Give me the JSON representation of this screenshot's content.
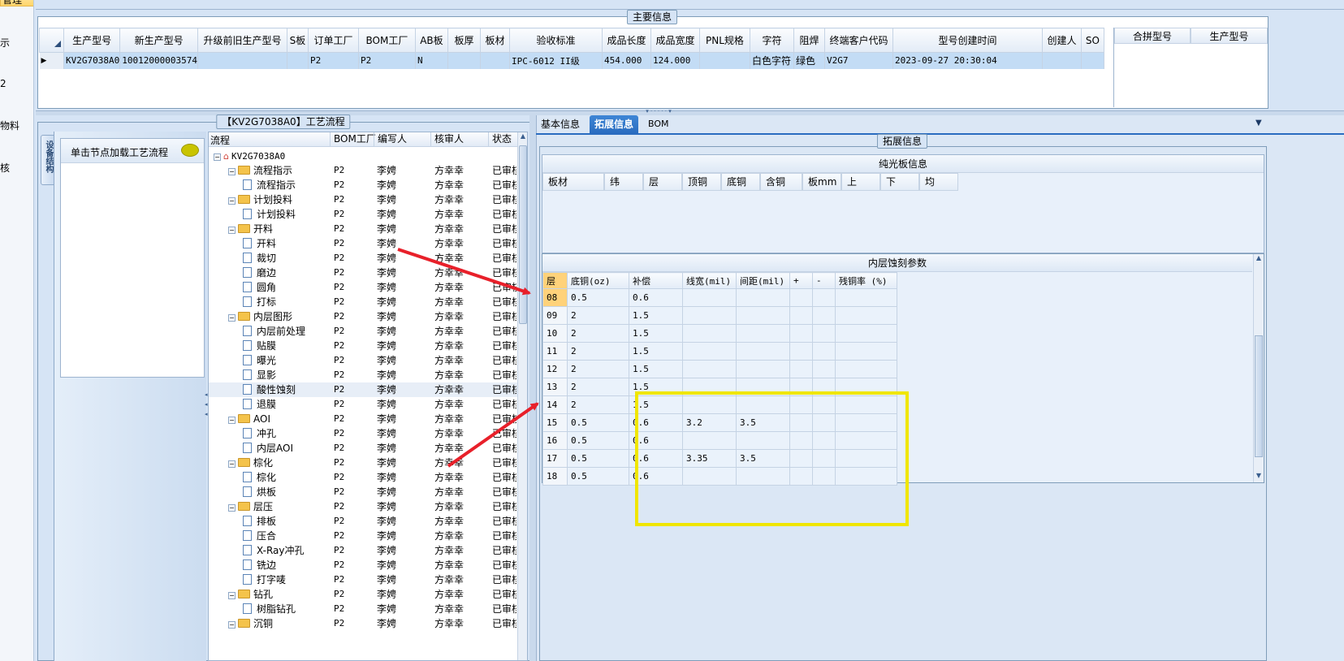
{
  "left_nav": {
    "items": [
      {
        "label": "管理",
        "selected": true
      },
      {
        "label": "示"
      },
      {
        "label": "2"
      },
      {
        "label": "物料"
      },
      {
        "label": "核"
      }
    ]
  },
  "main_info": {
    "title": "主要信息",
    "columns": [
      "生产型号",
      "新生产型号",
      "升级前旧生产型号",
      "S板",
      "订单工厂",
      "BOM工厂",
      "AB板",
      "板厚",
      "板材",
      "验收标准",
      "成品长度",
      "成品宽度",
      "PNL规格",
      "字符",
      "阻焊",
      "终端客户代码",
      "型号创建时间",
      "创建人",
      "SO"
    ],
    "row": [
      "KV2G7038A0",
      "10012000003574",
      "",
      "",
      "P2",
      "P2",
      "N",
      "",
      "",
      "IPC-6012 II级",
      "454.000",
      "124.000",
      "",
      "白色字符",
      "绿色",
      "V2G7",
      "2023-09-27 20:30:04",
      "",
      ""
    ],
    "side_columns": [
      "合拼型号",
      "生产型号"
    ]
  },
  "process_panel": {
    "title": "【KV2G7038A0】工艺流程",
    "vertical_tab": "设备结构",
    "load_hint": "单击节点加载工艺流程",
    "tree_headers": [
      "流程",
      "BOM工厂",
      "编写人",
      "核审人",
      "状态"
    ],
    "tree_rows": [
      {
        "name": "KV2G7038A0",
        "level": 0,
        "type": "root",
        "bom": "",
        "writer": "",
        "reviewer": "",
        "status": ""
      },
      {
        "name": "流程指示",
        "level": 1,
        "type": "folder",
        "bom": "P2",
        "writer": "李娉",
        "reviewer": "方幸幸",
        "status": "已审核"
      },
      {
        "name": "流程指示",
        "level": 2,
        "type": "doc",
        "bom": "P2",
        "writer": "李娉",
        "reviewer": "方幸幸",
        "status": "已审核"
      },
      {
        "name": "计划投料",
        "level": 1,
        "type": "folder",
        "bom": "P2",
        "writer": "李娉",
        "reviewer": "方幸幸",
        "status": "已审核"
      },
      {
        "name": "计划投料",
        "level": 2,
        "type": "doc",
        "bom": "P2",
        "writer": "李娉",
        "reviewer": "方幸幸",
        "status": "已审核"
      },
      {
        "name": "开料",
        "level": 1,
        "type": "folder",
        "bom": "P2",
        "writer": "李娉",
        "reviewer": "方幸幸",
        "status": "已审核"
      },
      {
        "name": "开料",
        "level": 2,
        "type": "doc",
        "bom": "P2",
        "writer": "李娉",
        "reviewer": "方幸幸",
        "status": "已审核"
      },
      {
        "name": "裁切",
        "level": 2,
        "type": "doc",
        "bom": "P2",
        "writer": "李娉",
        "reviewer": "方幸幸",
        "status": "已审核"
      },
      {
        "name": "磨边",
        "level": 2,
        "type": "doc",
        "bom": "P2",
        "writer": "李娉",
        "reviewer": "方幸幸",
        "status": "已审核"
      },
      {
        "name": "圆角",
        "level": 2,
        "type": "doc",
        "bom": "P2",
        "writer": "李娉",
        "reviewer": "方幸幸",
        "status": "已审核"
      },
      {
        "name": "打标",
        "level": 2,
        "type": "doc",
        "bom": "P2",
        "writer": "李娉",
        "reviewer": "方幸幸",
        "status": "已审核"
      },
      {
        "name": "内层图形",
        "level": 1,
        "type": "folder",
        "bom": "P2",
        "writer": "李娉",
        "reviewer": "方幸幸",
        "status": "已审核"
      },
      {
        "name": "内层前处理",
        "level": 2,
        "type": "doc",
        "bom": "P2",
        "writer": "李娉",
        "reviewer": "方幸幸",
        "status": "已审核"
      },
      {
        "name": "贴膜",
        "level": 2,
        "type": "doc",
        "bom": "P2",
        "writer": "李娉",
        "reviewer": "方幸幸",
        "status": "已审核"
      },
      {
        "name": "曝光",
        "level": 2,
        "type": "doc",
        "bom": "P2",
        "writer": "李娉",
        "reviewer": "方幸幸",
        "status": "已审核"
      },
      {
        "name": "显影",
        "level": 2,
        "type": "doc",
        "bom": "P2",
        "writer": "李娉",
        "reviewer": "方幸幸",
        "status": "已审核"
      },
      {
        "name": "酸性蚀刻",
        "level": 2,
        "type": "doc",
        "bom": "P2",
        "writer": "李娉",
        "reviewer": "方幸幸",
        "status": "已审核",
        "selected": true
      },
      {
        "name": "退膜",
        "level": 2,
        "type": "doc",
        "bom": "P2",
        "writer": "李娉",
        "reviewer": "方幸幸",
        "status": "已审核"
      },
      {
        "name": "AOI",
        "level": 1,
        "type": "folder",
        "bom": "P2",
        "writer": "李娉",
        "reviewer": "方幸幸",
        "status": "已审核"
      },
      {
        "name": "冲孔",
        "level": 2,
        "type": "doc",
        "bom": "P2",
        "writer": "李娉",
        "reviewer": "方幸幸",
        "status": "已审核"
      },
      {
        "name": "内层AOI",
        "level": 2,
        "type": "doc",
        "bom": "P2",
        "writer": "李娉",
        "reviewer": "方幸幸",
        "status": "已审核"
      },
      {
        "name": "棕化",
        "level": 1,
        "type": "folder",
        "bom": "P2",
        "writer": "李娉",
        "reviewer": "方幸幸",
        "status": "已审核"
      },
      {
        "name": "棕化",
        "level": 2,
        "type": "doc",
        "bom": "P2",
        "writer": "李娉",
        "reviewer": "方幸幸",
        "status": "已审核"
      },
      {
        "name": "烘板",
        "level": 2,
        "type": "doc",
        "bom": "P2",
        "writer": "李娉",
        "reviewer": "方幸幸",
        "status": "已审核"
      },
      {
        "name": "层压",
        "level": 1,
        "type": "folder",
        "bom": "P2",
        "writer": "李娉",
        "reviewer": "方幸幸",
        "status": "已审核"
      },
      {
        "name": "排板",
        "level": 2,
        "type": "doc",
        "bom": "P2",
        "writer": "李娉",
        "reviewer": "方幸幸",
        "status": "已审核"
      },
      {
        "name": "压合",
        "level": 2,
        "type": "doc",
        "bom": "P2",
        "writer": "李娉",
        "reviewer": "方幸幸",
        "status": "已审核"
      },
      {
        "name": "X-Ray冲孔",
        "level": 2,
        "type": "doc",
        "bom": "P2",
        "writer": "李娉",
        "reviewer": "方幸幸",
        "status": "已审核"
      },
      {
        "name": "铣边",
        "level": 2,
        "type": "doc",
        "bom": "P2",
        "writer": "李娉",
        "reviewer": "方幸幸",
        "status": "已审核"
      },
      {
        "name": "打字唛",
        "level": 2,
        "type": "doc",
        "bom": "P2",
        "writer": "李娉",
        "reviewer": "方幸幸",
        "status": "已审核"
      },
      {
        "name": "钻孔",
        "level": 1,
        "type": "folder",
        "bom": "P2",
        "writer": "李娉",
        "reviewer": "方幸幸",
        "status": "已审核"
      },
      {
        "name": "树脂钻孔",
        "level": 2,
        "type": "doc",
        "bom": "P2",
        "writer": "李娉",
        "reviewer": "方幸幸",
        "status": "已审核"
      },
      {
        "name": "沉铜",
        "level": 1,
        "type": "folder",
        "bom": "P2",
        "writer": "李娉",
        "reviewer": "方幸幸",
        "status": "已审核"
      }
    ]
  },
  "right_panel": {
    "tabs": [
      "基本信息",
      "拓展信息",
      "BOM"
    ],
    "active_tab": "拓展信息",
    "group_title": "拓展信息",
    "light_board": {
      "title": "纯光板信息",
      "columns": [
        "板材",
        "纬",
        "层",
        "顶铜",
        "底铜",
        "含铜",
        "板mm",
        "上",
        "下",
        "均"
      ]
    },
    "etch_params": {
      "title": "内层蚀刻参数",
      "columns": [
        "层",
        "底铜(oz)",
        "补偿",
        "线宽(mil)",
        "间距(mil)",
        "+",
        "-",
        "残铜率 (%)"
      ],
      "rows": [
        [
          "08",
          "0.5",
          "0.6",
          "",
          "",
          "",
          "",
          ""
        ],
        [
          "09",
          "2",
          "1.5",
          "",
          "",
          "",
          "",
          ""
        ],
        [
          "10",
          "2",
          "1.5",
          "",
          "",
          "",
          "",
          ""
        ],
        [
          "11",
          "2",
          "1.5",
          "",
          "",
          "",
          "",
          ""
        ],
        [
          "12",
          "2",
          "1.5",
          "",
          "",
          "",
          "",
          ""
        ],
        [
          "13",
          "2",
          "1.5",
          "",
          "",
          "",
          "",
          ""
        ],
        [
          "14",
          "2",
          "1.5",
          "",
          "",
          "",
          "",
          ""
        ],
        [
          "15",
          "0.5",
          "0.6",
          "3.2",
          "3.5",
          "",
          "",
          ""
        ],
        [
          "16",
          "0.5",
          "0.6",
          "",
          "",
          "",
          "",
          ""
        ],
        [
          "17",
          "0.5",
          "0.6",
          "3.35",
          "3.5",
          "",
          "",
          ""
        ],
        [
          "18",
          "0.5",
          "0.6",
          "",
          "",
          "",
          "",
          ""
        ]
      ]
    }
  },
  "colors": {
    "annotation_arrow": "#e8202a",
    "highlight_box": "#f0e600",
    "selection": "#c3dcf5",
    "active_tab": "#2a6cc0"
  }
}
